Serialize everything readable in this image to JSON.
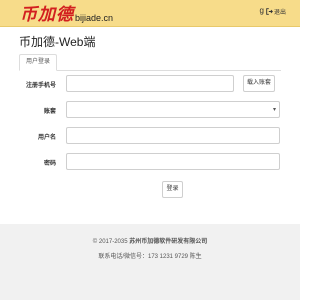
{
  "header": {
    "logo_cn": "币加德",
    "logo_en": "bijiade.cn",
    "user_initial": "g",
    "logout_label": "退出"
  },
  "page": {
    "title": "币加德-Web端"
  },
  "tabs": [
    {
      "label": "用户登录",
      "active": true
    }
  ],
  "form": {
    "phone_label": "注册手机号",
    "phone_value": "",
    "fill_account_button": "载入账套",
    "account_set_label": "账套",
    "account_set_value": "",
    "username_label": "用户名",
    "username_value": "",
    "password_label": "密码",
    "password_value": "",
    "login_button": "登录"
  },
  "footer": {
    "copyright_prefix": "© 2017-2035",
    "company": "苏州币加德软件研发有限公司",
    "contact": "联系电话/微信号：173 1231 9729 陈生"
  }
}
